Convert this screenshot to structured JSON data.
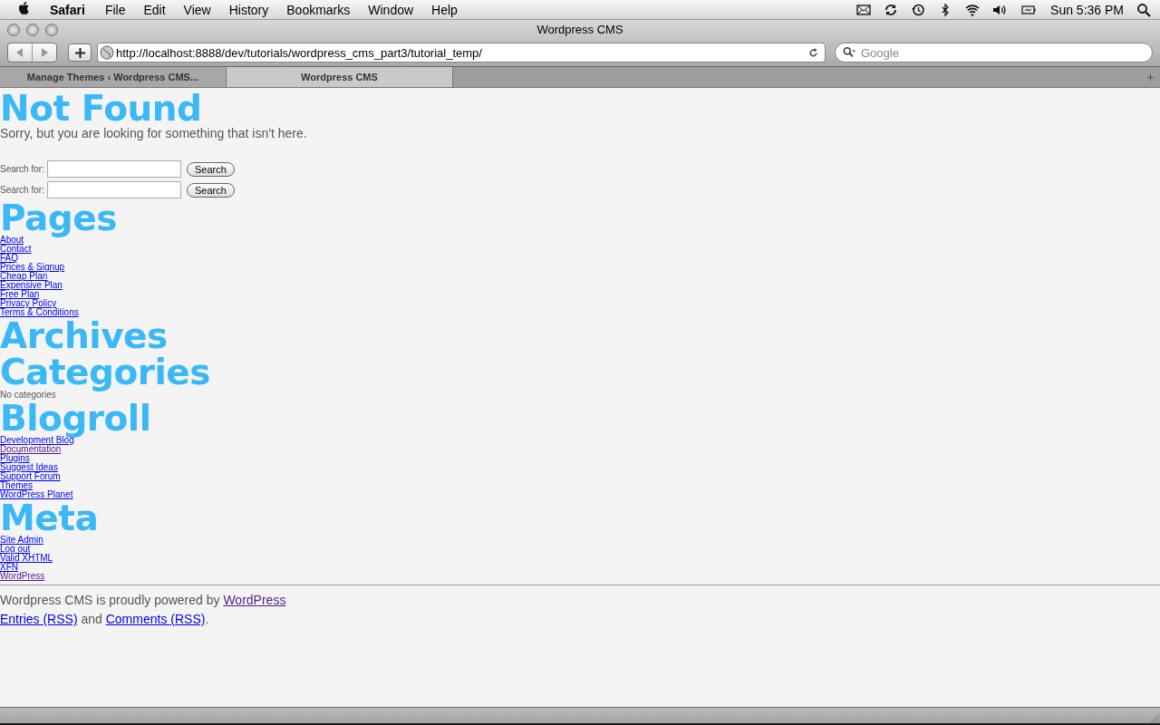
{
  "menubar": {
    "app": "Safari",
    "menus": [
      "File",
      "Edit",
      "View",
      "History",
      "Bookmarks",
      "Window",
      "Help"
    ],
    "clock": "Sun 5:36 PM"
  },
  "window": {
    "title": "Wordpress CMS"
  },
  "address": {
    "url": "http://localhost:8888/dev/tutorials/wordpress_cms_part3/tutorial_temp/"
  },
  "search": {
    "placeholder": "Google"
  },
  "tabs": [
    {
      "label": "Manage Themes ‹ Wordpress CMS...",
      "selected": false
    },
    {
      "label": "Wordpress CMS",
      "selected": true
    }
  ],
  "page": {
    "heading": "Not Found",
    "message": "Sorry, but you are looking for something that isn't here.",
    "search_forms": [
      {
        "label": "Search for:",
        "button": "Search"
      },
      {
        "label": "Search for:",
        "button": "Search"
      }
    ],
    "sections": [
      {
        "heading": "Pages",
        "items": [
          {
            "label": "About",
            "visited": false
          },
          {
            "label": "Contact",
            "visited": false
          },
          {
            "label": "FAQ",
            "visited": false
          },
          {
            "label": "Prices & Signup",
            "visited": false
          },
          {
            "label": "Cheap Plan",
            "visited": false
          },
          {
            "label": "Expensive Plan",
            "visited": false
          },
          {
            "label": "Free Plan",
            "visited": false
          },
          {
            "label": "Privacy Policy",
            "visited": false
          },
          {
            "label": "Terms & Conditions",
            "visited": false
          }
        ]
      },
      {
        "heading": "Archives"
      },
      {
        "heading": "Categories",
        "note": "No categories"
      },
      {
        "heading": "Blogroll",
        "items": [
          {
            "label": "Development Blog",
            "visited": false
          },
          {
            "label": "Documentation",
            "visited": true
          },
          {
            "label": "Plugins",
            "visited": false
          },
          {
            "label": "Suggest Ideas",
            "visited": false
          },
          {
            "label": "Support Forum",
            "visited": false
          },
          {
            "label": "Themes",
            "visited": false
          },
          {
            "label": "WordPress Planet",
            "visited": false
          }
        ]
      },
      {
        "heading": "Meta",
        "items": [
          {
            "label": "Site Admin",
            "visited": false
          },
          {
            "label": "Log out",
            "visited": false
          },
          {
            "label": "Valid XHTML",
            "visited": false
          },
          {
            "label": "XFN",
            "visited": false
          },
          {
            "label": "WordPress",
            "visited": true
          }
        ]
      }
    ],
    "footer": {
      "powered_text": "Wordpress CMS is proudly powered by",
      "powered_link": {
        "label": "WordPress",
        "visited": true
      },
      "entries_link": {
        "label": "Entries (RSS)",
        "visited": false
      },
      "and_text": "and",
      "comments_link": {
        "label": "Comments (RSS)",
        "visited": false
      },
      "end_text": "."
    }
  }
}
